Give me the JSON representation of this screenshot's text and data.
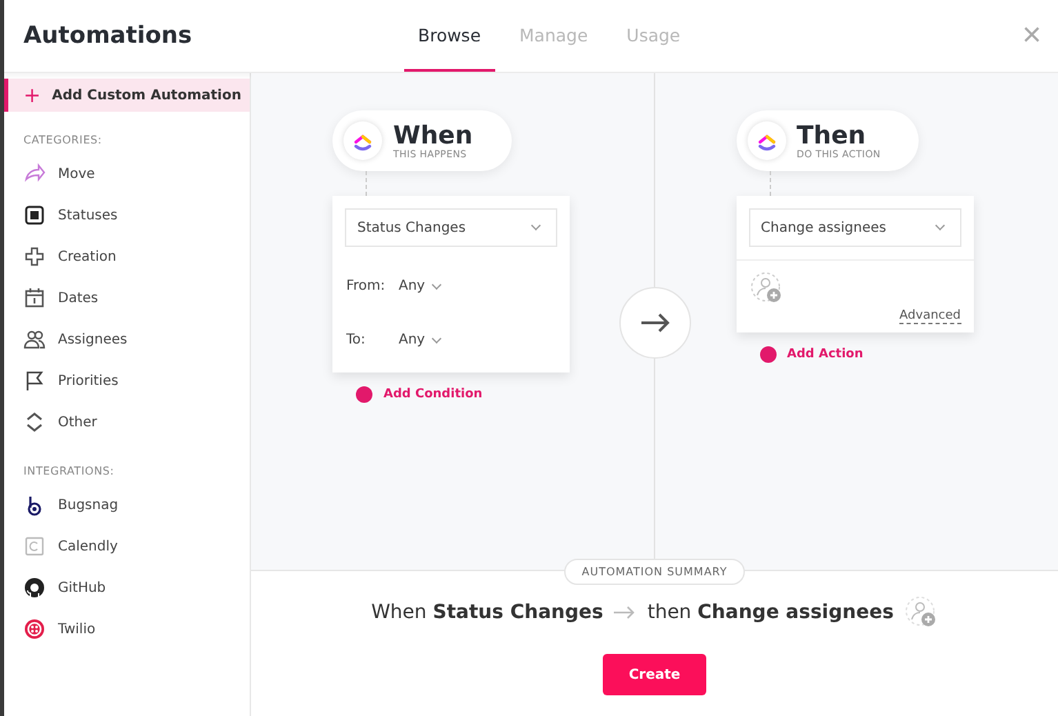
{
  "window": {
    "title": "Automations",
    "close": "×"
  },
  "tabs": [
    {
      "label": "Browse",
      "selected": true
    },
    {
      "label": "Manage",
      "selected": false
    },
    {
      "label": "Usage",
      "selected": false
    }
  ],
  "sidebar": {
    "add_button": {
      "icon": "+",
      "label": "Add Custom Automation",
      "selected": true
    },
    "sections": [
      {
        "heading": "CATEGORIES:",
        "items": [
          "Move",
          "Statuses",
          "Creation",
          "Dates",
          "Assignees",
          "Priorities",
          "Other"
        ]
      },
      {
        "heading": "INTEGRATIONS:",
        "items": [
          "Bugsnag",
          "Calendly",
          "GitHub",
          "Twilio"
        ]
      }
    ]
  },
  "trigger": {
    "title": "When",
    "subtitle": "THIS HAPPENS",
    "select": "Status Changes",
    "fields": [
      {
        "label": "From:",
        "value": "Any"
      },
      {
        "label": "To:",
        "value": "Any"
      }
    ],
    "add_link": "Add Condition"
  },
  "action": {
    "title": "Then",
    "subtitle": "DO THIS ACTION",
    "select": "Change assignees",
    "advanced": "Advanced",
    "add_link": "Add Action"
  },
  "summary": {
    "heading": "AUTOMATION SUMMARY",
    "when": "When **Status Changes**",
    "then": "then **Change assignees**"
  },
  "create_button": "Create"
}
